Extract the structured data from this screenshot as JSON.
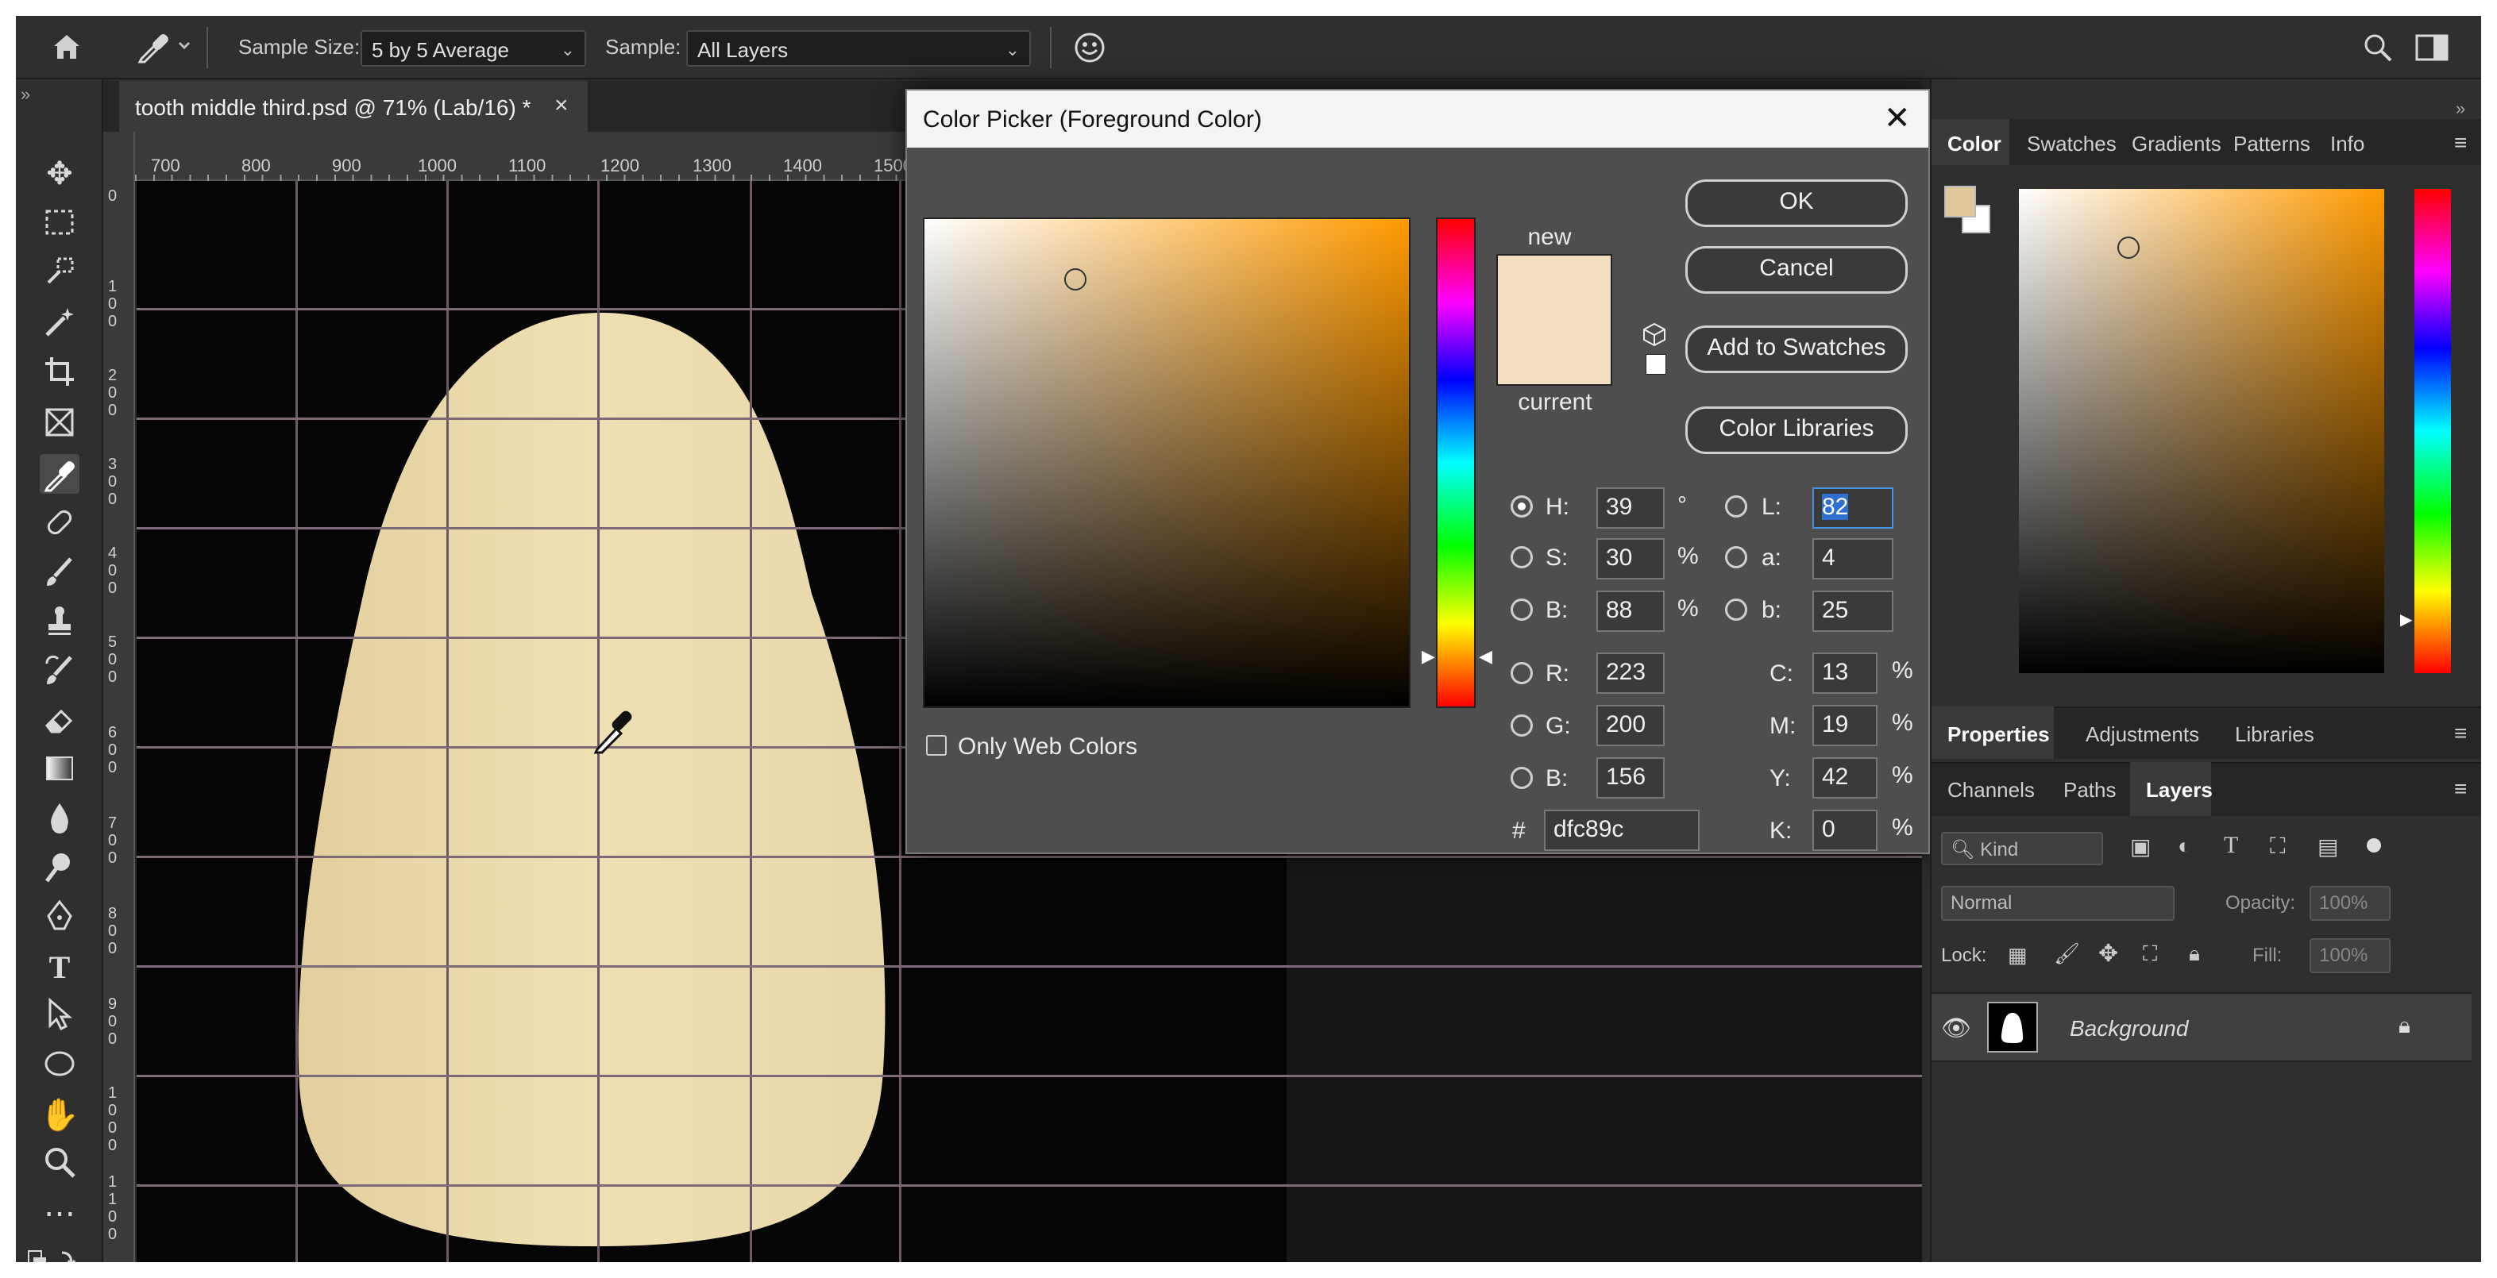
{
  "option_bar": {
    "sample_size_label": "Sample Size:",
    "sample_size_value": "5 by 5 Average",
    "sample_label": "Sample:",
    "sample_value": "All Layers"
  },
  "document": {
    "tab_title": "tooth middle third.psd @ 71% (Lab/16) *",
    "ruler_top": [
      "700",
      "800",
      "900",
      "1000",
      "1100",
      "1200",
      "1300",
      "1400",
      "1500"
    ],
    "ruler_left": [
      "0",
      "100",
      "200",
      "300",
      "400",
      "500",
      "600",
      "700",
      "800",
      "900",
      "1000",
      "1100"
    ]
  },
  "color_picker": {
    "title": "Color Picker (Foreground Color)",
    "new_label": "new",
    "current_label": "current",
    "buttons": {
      "ok": "OK",
      "cancel": "Cancel",
      "add_to_swatches": "Add to Swatches",
      "color_libraries": "Color Libraries"
    },
    "only_web_colors": "Only Web Colors",
    "hsb": {
      "h_label": "H:",
      "h": "39",
      "h_unit": "°",
      "s_label": "S:",
      "s": "30",
      "s_unit": "%",
      "b_label": "B:",
      "b": "88",
      "b_unit": "%"
    },
    "rgb": {
      "r_label": "R:",
      "r": "223",
      "g_label": "G:",
      "g": "200",
      "b_label": "B:",
      "b": "156"
    },
    "lab": {
      "l_label": "L:",
      "l": "82",
      "a_label": "a:",
      "a": "4",
      "b_label": "b:",
      "b": "25"
    },
    "cmyk": {
      "c_label": "C:",
      "c": "13",
      "m_label": "M:",
      "m": "19",
      "y_label": "Y:",
      "y": "42",
      "k_label": "K:",
      "k": "0",
      "unit": "%"
    },
    "hex_label": "#",
    "hex": "dfc89c",
    "new_color": "#f3dfc0",
    "hue_color": "#ff9a00"
  },
  "color_panel": {
    "tabs": [
      "Color",
      "Swatches",
      "Gradients",
      "Patterns",
      "Info"
    ],
    "foreground": "#dfc89c",
    "background": "#ffffff"
  },
  "properties_panel": {
    "tabs": [
      "Properties",
      "Adjustments",
      "Libraries"
    ]
  },
  "layers_panel": {
    "tabs": [
      "Channels",
      "Paths",
      "Layers"
    ],
    "filter_label": "Kind",
    "blend_mode": "Normal",
    "opacity_label": "Opacity:",
    "opacity_value": "100%",
    "lock_label": "Lock:",
    "fill_label": "Fill:",
    "fill_value": "100%",
    "layer_name": "Background"
  }
}
